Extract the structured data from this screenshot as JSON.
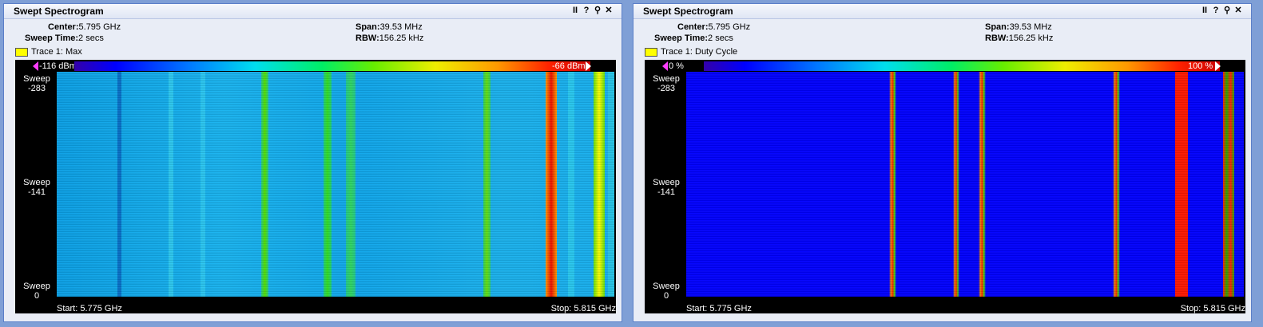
{
  "panels": [
    {
      "title": "Swept Spectrogram",
      "center_label": "Center:",
      "center_value": "5.795 GHz",
      "span_label": "Span:",
      "span_value": "39.53 MHz",
      "sweep_time_label": "Sweep Time:",
      "sweep_time_value": "2 secs",
      "rbw_label": "RBW:",
      "rbw_value": "156.25 kHz",
      "trace": "Trace 1: Max",
      "scale_min": "-116 dBm",
      "scale_max": "-66 dBm",
      "y_top": [
        "Sweep",
        "-283"
      ],
      "y_mid": [
        "Sweep",
        "-141"
      ],
      "y_bot": [
        "Sweep",
        "0"
      ],
      "start": "Start: 5.775 GHz",
      "stop": "Stop: 5.815 GHz"
    },
    {
      "title": "Swept Spectrogram",
      "center_label": "Center:",
      "center_value": "5.795 GHz",
      "span_label": "Span:",
      "span_value": "39.53 MHz",
      "sweep_time_label": "Sweep Time:",
      "sweep_time_value": "2 secs",
      "rbw_label": "RBW:",
      "rbw_value": "156.25 kHz",
      "trace": "Trace 1: Duty Cycle",
      "scale_min": "0 %",
      "scale_max": "100 %",
      "y_top": [
        "Sweep",
        "-283"
      ],
      "y_mid": [
        "Sweep",
        "-141"
      ],
      "y_bot": [
        "Sweep",
        "0"
      ],
      "start": "Start: 5.775 GHz",
      "stop": "Stop: 5.815 GHz"
    }
  ],
  "window_buttons": {
    "pause": "II",
    "help": "?",
    "zoom": "⚲",
    "close": "✕"
  },
  "trace_color": "#ffff00",
  "colors": {
    "background": "#7f9fd6",
    "plot_bg": "#000000",
    "duty_base": "#0000ff"
  }
}
